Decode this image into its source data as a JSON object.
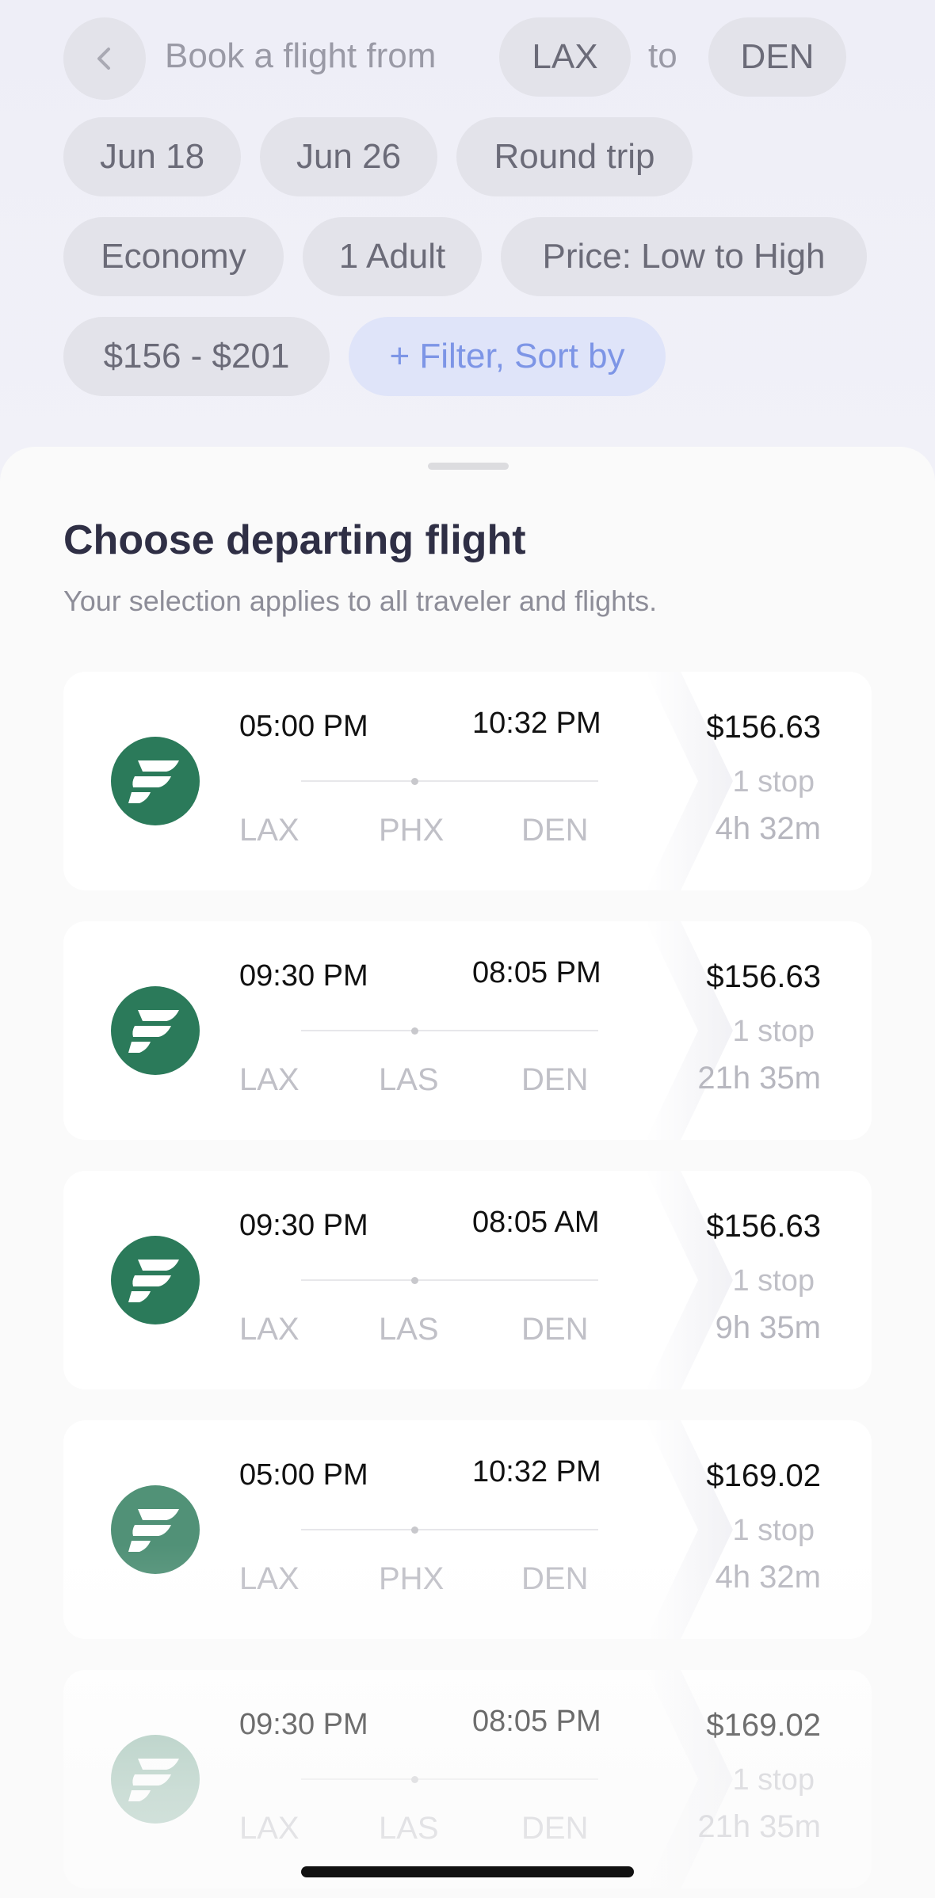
{
  "header": {
    "back_icon": "chevron-left-icon",
    "book_label": "Book a flight from",
    "origin": "LAX",
    "to_label": "to",
    "destination": "DEN",
    "depart_date": "Jun 18",
    "return_date": "Jun 26",
    "trip_type": "Round trip",
    "cabin": "Economy",
    "passengers": "1 Adult",
    "sort": "Price: Low to High",
    "price_range": "$156 - $201",
    "filter_label": "+ Filter, Sort by"
  },
  "sheet": {
    "title": "Choose departing flight",
    "subtitle": "Your selection applies to all traveler and flights."
  },
  "colors": {
    "airline_green": "#2b7a5a",
    "filter_blue": "#7d95e6"
  },
  "flights": [
    {
      "dep": "05:00 PM",
      "arr": "10:32 PM",
      "from": "LAX",
      "via": "PHX",
      "to": "DEN",
      "price": "$156.63",
      "stops": "1 stop",
      "duration": "4h 32m",
      "logo_icon": "airline-logo-icon"
    },
    {
      "dep": "09:30 PM",
      "arr": "08:05 PM",
      "from": "LAX",
      "via": "LAS",
      "to": "DEN",
      "price": "$156.63",
      "stops": "1 stop",
      "duration": "21h 35m",
      "logo_icon": "airline-logo-icon"
    },
    {
      "dep": "09:30 PM",
      "arr": "08:05 AM",
      "from": "LAX",
      "via": "LAS",
      "to": "DEN",
      "price": "$156.63",
      "stops": "1 stop",
      "duration": "9h 35m",
      "logo_icon": "airline-logo-icon"
    },
    {
      "dep": "05:00 PM",
      "arr": "10:32 PM",
      "from": "LAX",
      "via": "PHX",
      "to": "DEN",
      "price": "$169.02",
      "stops": "1 stop",
      "duration": "4h 32m",
      "logo_icon": "airline-logo-icon"
    },
    {
      "dep": "09:30 PM",
      "arr": "08:05 PM",
      "from": "LAX",
      "via": "LAS",
      "to": "DEN",
      "price": "$169.02",
      "stops": "1 stop",
      "duration": "21h 35m",
      "logo_icon": "airline-logo-icon"
    }
  ],
  "side_tab_icon": "home-icon"
}
